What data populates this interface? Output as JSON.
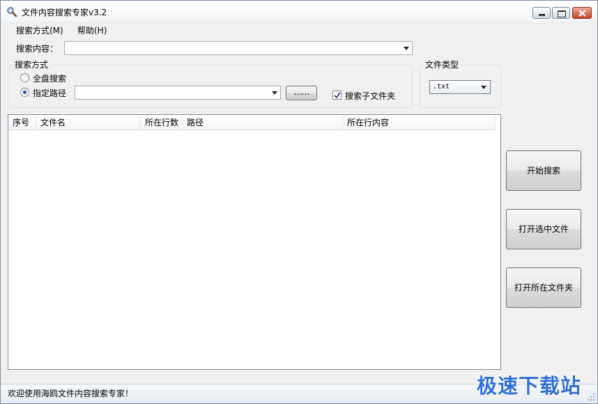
{
  "window": {
    "title": "文件内容搜索专家v3.2",
    "icon": "magnifier-icon"
  },
  "menu": [
    {
      "label": "搜索方式(M)"
    },
    {
      "label": "帮助(H)"
    }
  ],
  "search": {
    "label": "搜索内容：",
    "value": ""
  },
  "search_mode": {
    "group_title": "搜索方式",
    "option_all_disks": "全盘搜索",
    "option_specific_path": "指定路径",
    "selected": "指定路径",
    "path_value": "",
    "browse_label": "……",
    "subfolder_label": "搜索子文件夹",
    "subfolder_checked": true
  },
  "file_type": {
    "group_title": "文件类型",
    "selected": ".txt"
  },
  "results": {
    "columns": [
      "序号",
      "文件名",
      "所在行数",
      "路径",
      "所在行内容"
    ],
    "rows": []
  },
  "actions": {
    "start_search": "开始搜索",
    "open_selected_file": "打开选中文件",
    "open_containing_folder": "打开所在文件夹"
  },
  "status": {
    "text": "欢迎使用海鸥文件内容搜索专家！"
  },
  "watermark": {
    "text": "极速下载站"
  }
}
